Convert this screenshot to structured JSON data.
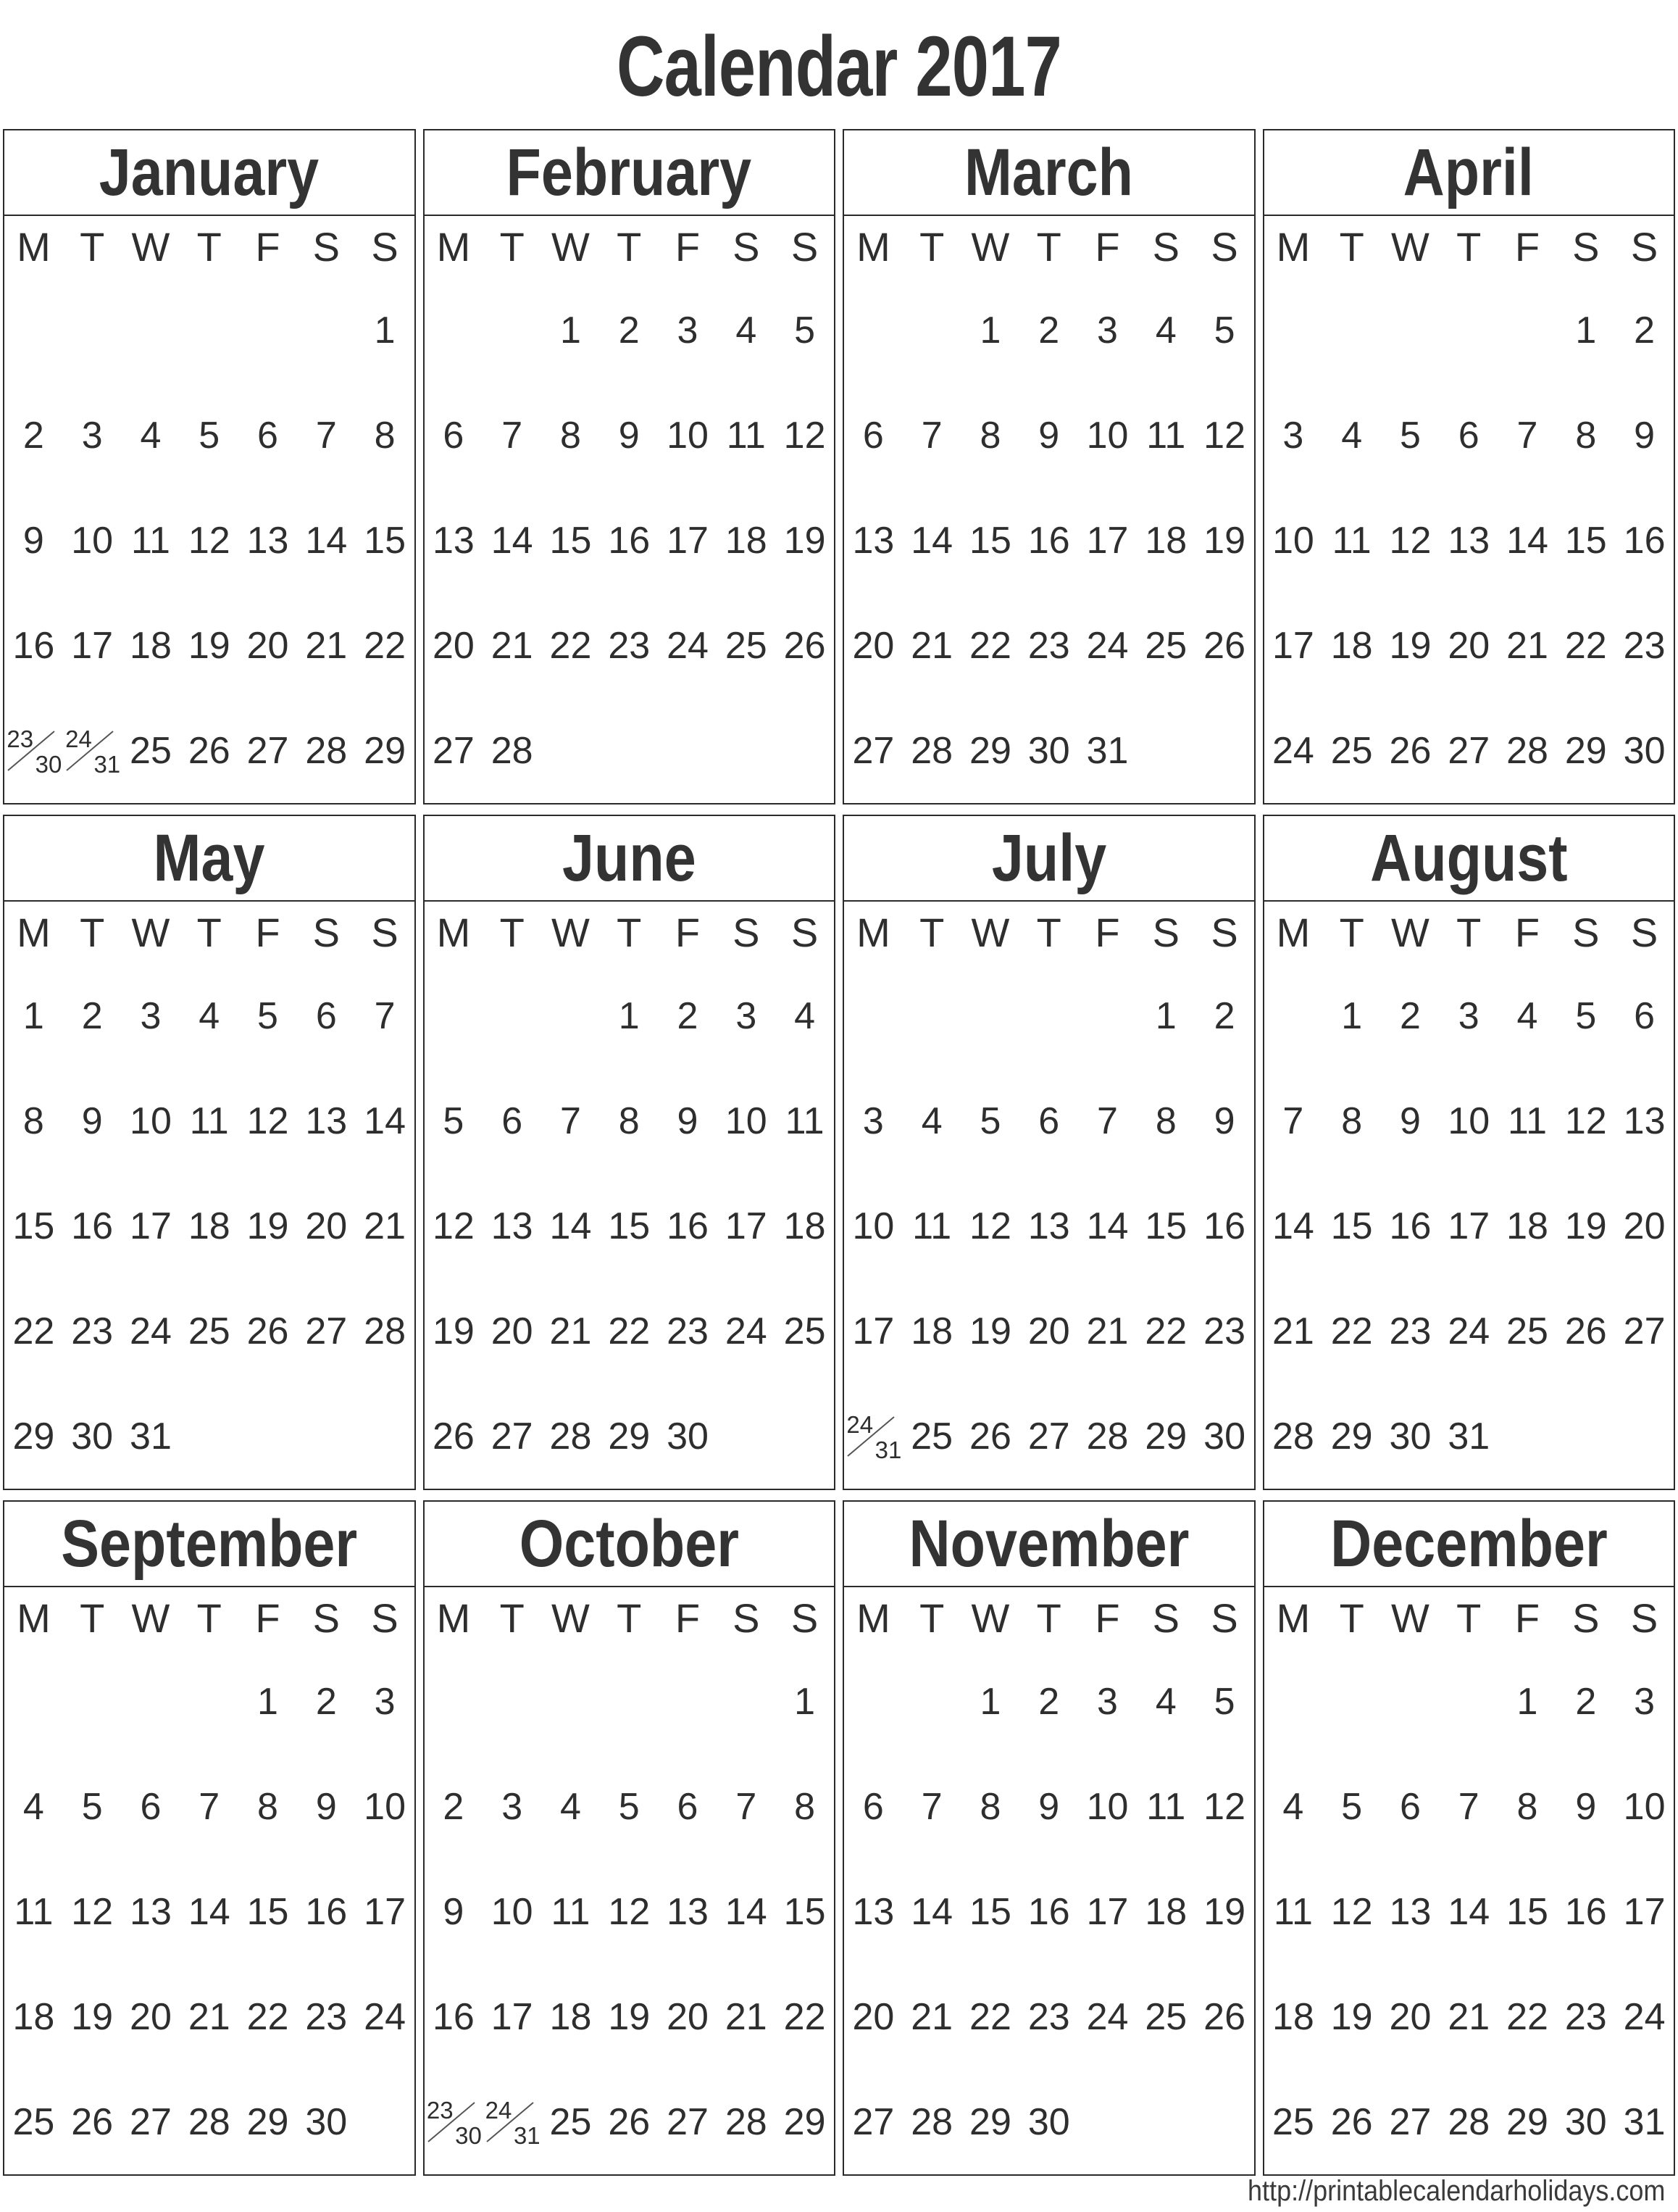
{
  "title": "Calendar 2017",
  "year": "2017",
  "colors": {
    "weekend_red": "#e03a33",
    "text_dark": "#2e2e2e",
    "heading_dark": "#333333",
    "border": "#2b2b2b"
  },
  "weekday_headers": [
    "M",
    "T",
    "W",
    "T",
    "F",
    "S",
    "S"
  ],
  "weekend_header_indices": [
    5,
    6
  ],
  "footer": {
    "url": "http://printablecalendarholidays.com"
  },
  "months": [
    {
      "name": "January",
      "weeks": [
        [
          "",
          "",
          "",
          "",
          "",
          "",
          "1"
        ],
        [
          "2",
          "3",
          "4",
          "5",
          "6",
          "7",
          "8"
        ],
        [
          "9",
          "10",
          "11",
          "12",
          "13",
          "14",
          "15"
        ],
        [
          "16",
          "17",
          "18",
          "19",
          "20",
          "21",
          "22"
        ],
        [
          {
            "top": "23",
            "bottom": "30"
          },
          {
            "top": "24",
            "bottom": "31"
          },
          "25",
          "26",
          "27",
          "28",
          "29"
        ]
      ]
    },
    {
      "name": "February",
      "weeks": [
        [
          "",
          "",
          "1",
          "2",
          "3",
          "4",
          "5"
        ],
        [
          "6",
          "7",
          "8",
          "9",
          "10",
          "11",
          "12"
        ],
        [
          "13",
          "14",
          "15",
          "16",
          "17",
          "18",
          "19"
        ],
        [
          "20",
          "21",
          "22",
          "23",
          "24",
          "25",
          "26"
        ],
        [
          "27",
          "28",
          "",
          "",
          "",
          "",
          ""
        ]
      ]
    },
    {
      "name": "March",
      "weeks": [
        [
          "",
          "",
          "1",
          "2",
          "3",
          "4",
          "5"
        ],
        [
          "6",
          "7",
          "8",
          "9",
          "10",
          "11",
          "12"
        ],
        [
          "13",
          "14",
          "15",
          "16",
          "17",
          "18",
          "19"
        ],
        [
          "20",
          "21",
          "22",
          "23",
          "24",
          "25",
          "26"
        ],
        [
          "27",
          "28",
          "29",
          "30",
          "31",
          "",
          ""
        ]
      ]
    },
    {
      "name": "April",
      "weeks": [
        [
          "",
          "",
          "",
          "",
          "",
          "1",
          "2"
        ],
        [
          "3",
          "4",
          "5",
          "6",
          "7",
          "8",
          "9"
        ],
        [
          "10",
          "11",
          "12",
          "13",
          "14",
          "15",
          "16"
        ],
        [
          "17",
          "18",
          "19",
          "20",
          "21",
          "22",
          "23"
        ],
        [
          "24",
          "25",
          "26",
          "27",
          "28",
          "29",
          "30"
        ]
      ]
    },
    {
      "name": "May",
      "weeks": [
        [
          "1",
          "2",
          "3",
          "4",
          "5",
          "6",
          "7"
        ],
        [
          "8",
          "9",
          "10",
          "11",
          "12",
          "13",
          "14"
        ],
        [
          "15",
          "16",
          "17",
          "18",
          "19",
          "20",
          "21"
        ],
        [
          "22",
          "23",
          "24",
          "25",
          "26",
          "27",
          "28"
        ],
        [
          "29",
          "30",
          "31",
          "",
          "",
          "",
          ""
        ]
      ]
    },
    {
      "name": "June",
      "weeks": [
        [
          "",
          "",
          "",
          "1",
          "2",
          "3",
          "4"
        ],
        [
          "5",
          "6",
          "7",
          "8",
          "9",
          "10",
          "11"
        ],
        [
          "12",
          "13",
          "14",
          "15",
          "16",
          "17",
          "18"
        ],
        [
          "19",
          "20",
          "21",
          "22",
          "23",
          "24",
          "25"
        ],
        [
          "26",
          "27",
          "28",
          "29",
          "30",
          "",
          ""
        ]
      ]
    },
    {
      "name": "July",
      "weeks": [
        [
          "",
          "",
          "",
          "",
          "",
          "1",
          "2"
        ],
        [
          "3",
          "4",
          "5",
          "6",
          "7",
          "8",
          "9"
        ],
        [
          "10",
          "11",
          "12",
          "13",
          "14",
          "15",
          "16"
        ],
        [
          "17",
          "18",
          "19",
          "20",
          "21",
          "22",
          "23"
        ],
        [
          {
            "top": "24",
            "bottom": "31"
          },
          "25",
          "26",
          "27",
          "28",
          "29",
          "30"
        ]
      ]
    },
    {
      "name": "August",
      "weeks": [
        [
          "",
          "1",
          "2",
          "3",
          "4",
          "5",
          "6"
        ],
        [
          "7",
          "8",
          "9",
          "10",
          "11",
          "12",
          "13"
        ],
        [
          "14",
          "15",
          "16",
          "17",
          "18",
          "19",
          "20"
        ],
        [
          "21",
          "22",
          "23",
          "24",
          "25",
          "26",
          "27"
        ],
        [
          "28",
          "29",
          "30",
          "31",
          "",
          "",
          ""
        ]
      ]
    },
    {
      "name": "September",
      "weeks": [
        [
          "",
          "",
          "",
          "",
          "1",
          "2",
          "3"
        ],
        [
          "4",
          "5",
          "6",
          "7",
          "8",
          "9",
          "10"
        ],
        [
          "11",
          "12",
          "13",
          "14",
          "15",
          "16",
          "17"
        ],
        [
          "18",
          "19",
          "20",
          "21",
          "22",
          "23",
          "24"
        ],
        [
          "25",
          "26",
          "27",
          "28",
          "29",
          "30",
          ""
        ]
      ]
    },
    {
      "name": "October",
      "weeks": [
        [
          "",
          "",
          "",
          "",
          "",
          "",
          "1"
        ],
        [
          "2",
          "3",
          "4",
          "5",
          "6",
          "7",
          "8"
        ],
        [
          "9",
          "10",
          "11",
          "12",
          "13",
          "14",
          "15"
        ],
        [
          "16",
          "17",
          "18",
          "19",
          "20",
          "21",
          "22"
        ],
        [
          {
            "top": "23",
            "bottom": "30"
          },
          {
            "top": "24",
            "bottom": "31"
          },
          "25",
          "26",
          "27",
          "28",
          "29"
        ]
      ]
    },
    {
      "name": "November",
      "weeks": [
        [
          "",
          "",
          "1",
          "2",
          "3",
          "4",
          "5"
        ],
        [
          "6",
          "7",
          "8",
          "9",
          "10",
          "11",
          "12"
        ],
        [
          "13",
          "14",
          "15",
          "16",
          "17",
          "18",
          "19"
        ],
        [
          "20",
          "21",
          "22",
          "23",
          "24",
          "25",
          "26"
        ],
        [
          "27",
          "28",
          "29",
          "30",
          "",
          "",
          ""
        ]
      ]
    },
    {
      "name": "December",
      "weeks": [
        [
          "",
          "",
          "",
          "",
          "1",
          "2",
          "3"
        ],
        [
          "4",
          "5",
          "6",
          "7",
          "8",
          "9",
          "10"
        ],
        [
          "11",
          "12",
          "13",
          "14",
          "15",
          "16",
          "17"
        ],
        [
          "18",
          "19",
          "20",
          "21",
          "22",
          "23",
          "24"
        ],
        [
          "25",
          "26",
          "27",
          "28",
          "29",
          "30",
          "31"
        ]
      ]
    }
  ]
}
